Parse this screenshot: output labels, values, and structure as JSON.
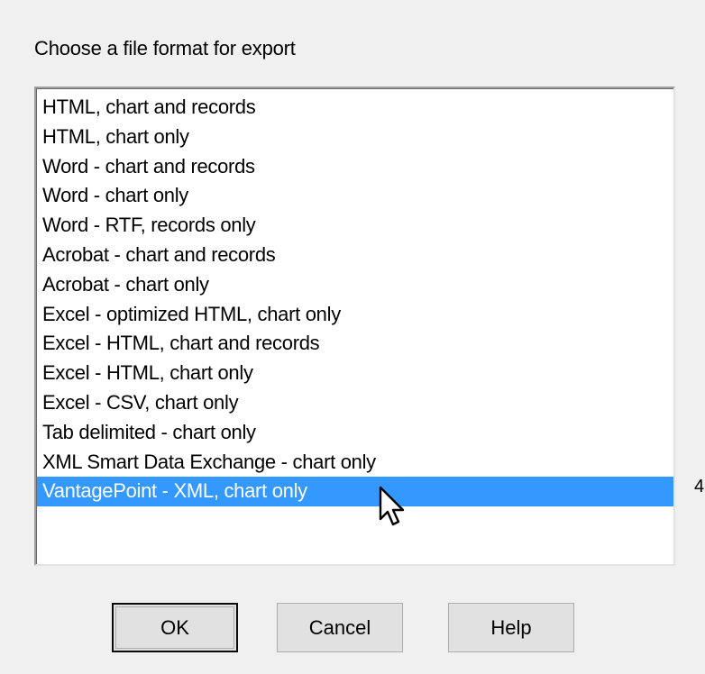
{
  "prompt": "Choose a file format for export",
  "formats": [
    "HTML, chart and records",
    "HTML, chart only",
    "Word - chart and records",
    "Word - chart only",
    "Word - RTF, records only",
    "Acrobat - chart and records",
    "Acrobat - chart only",
    "Excel - optimized HTML, chart only",
    "Excel - HTML, chart and records",
    "Excel - HTML, chart only",
    "Excel - CSV, chart only",
    "Tab delimited - chart only",
    "XML Smart Data Exchange - chart only",
    "VantagePoint - XML, chart only"
  ],
  "selected_format": "VantagePoint - XML, chart only",
  "buttons": {
    "ok": "OK",
    "cancel": "Cancel",
    "help": "Help"
  },
  "side_mark": "4",
  "colors": {
    "dialog_bg": "#f0f0f0",
    "selection_bg": "#3399ff",
    "selection_text": "#ffffff",
    "button_bg": "#e1e1e1"
  },
  "icons": {
    "pointer": "mouse-pointer-icon"
  }
}
